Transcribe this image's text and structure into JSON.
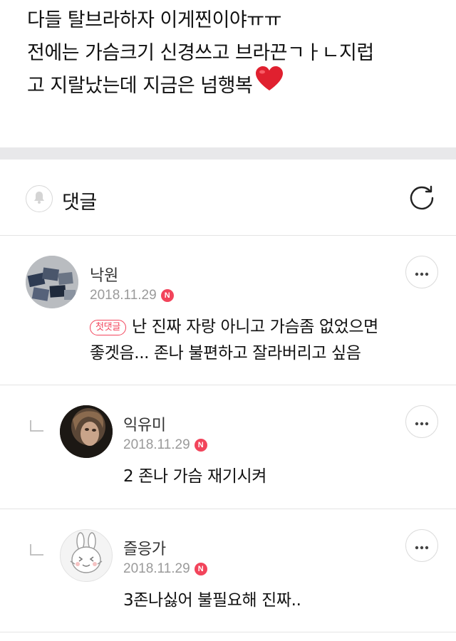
{
  "post": {
    "lines": [
      "다들 탈브라하자 이게찐이야ㅠㅠ",
      "전에는 가슴크기 신경쓰고 브라끈ㄱㅏㄴ지럽",
      "고 지랄났는데 지금은 넘행복"
    ],
    "trailing_emoji": "heart-emoji"
  },
  "comments_header": {
    "title": "댓글",
    "icons": [
      "bell-icon",
      "refresh-icon"
    ]
  },
  "comments": [
    {
      "author": "낙원",
      "date": "2018.11.29",
      "badge": "N",
      "first_comment_label": "첫댓글",
      "text_lines": [
        "난 진짜 자랑 아니고 가슴좀 없었으면",
        "좋겟음... 존나 불편하고 잘라버리고 싶음"
      ],
      "avatar": "photo-avatar",
      "is_reply": false
    },
    {
      "author": "익유미",
      "date": "2018.11.29",
      "badge": "N",
      "text_lines": [
        "2 존나 가슴 재기시켜"
      ],
      "avatar": "portrait-avatar",
      "is_reply": true
    },
    {
      "author": "즐응가",
      "date": "2018.11.29",
      "badge": "N",
      "text_lines": [
        "3존나싫어 불필요해 진짜.."
      ],
      "avatar": "rabbit-avatar",
      "is_reply": true
    }
  ],
  "colors": {
    "accent_red": "#f2445b",
    "divider_band": "#e8e8ea",
    "date_gray": "#9a9a9a"
  }
}
